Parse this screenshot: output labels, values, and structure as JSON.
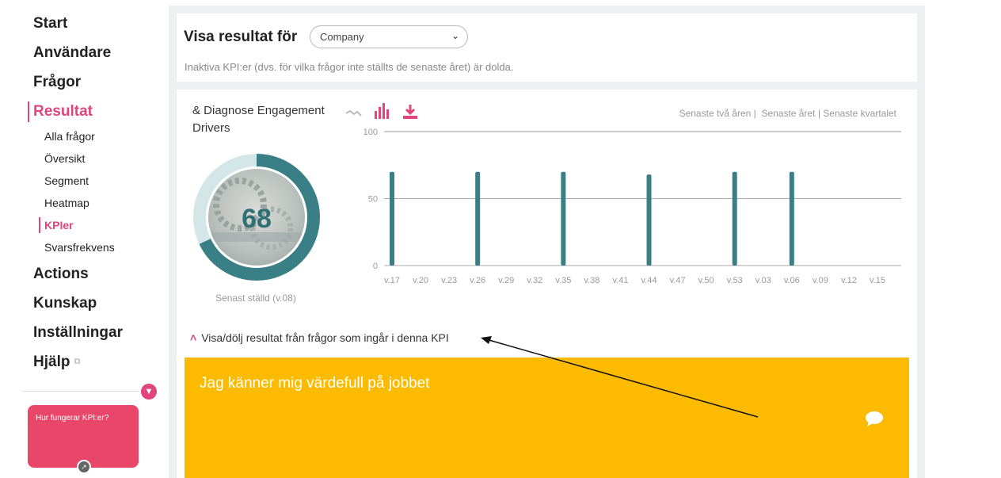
{
  "sidebar": {
    "nav": [
      {
        "label": "Start"
      },
      {
        "label": "Användare"
      },
      {
        "label": "Frågor"
      },
      {
        "label": "Resultat"
      },
      {
        "label": "Actions"
      },
      {
        "label": "Kunskap"
      },
      {
        "label": "Inställningar"
      },
      {
        "label": "Hjälp"
      }
    ],
    "sub": [
      {
        "label": "Alla frågor"
      },
      {
        "label": "Översikt"
      },
      {
        "label": "Segment"
      },
      {
        "label": "Heatmap"
      },
      {
        "label": "KPIer"
      },
      {
        "label": "Svarsfrekvens"
      }
    ],
    "help_card": "Hur fungerar KPI:er?"
  },
  "filter": {
    "title": "Visa resultat för",
    "selected": "Company",
    "note": "Inaktiva KPI:er (dvs. för vilka frågor inte ställts de senaste året) är dolda."
  },
  "kpi": {
    "title": "& Diagnose Engagement Drivers",
    "score": "68",
    "score_value": 68,
    "last_asked": "Senast ställd (v.08)",
    "periods": [
      "Senaste två åren",
      "Senaste året",
      "Senaste kvartalet"
    ],
    "toggle_label": "Visa/dölj resultat från frågor som ingår i denna KPI"
  },
  "colors": {
    "accent": "#e0457b",
    "teal": "#3a7f86",
    "yellow": "#fdbb00"
  },
  "chart_data": {
    "type": "bar",
    "categories": [
      "v.17",
      "v.20",
      "v.23",
      "v.26",
      "v.29",
      "v.32",
      "v.35",
      "v.38",
      "v.41",
      "v.44",
      "v.47",
      "v.50",
      "v.53",
      "v.03",
      "v.06",
      "v.09",
      "v.12",
      "v.15"
    ],
    "values": [
      70,
      null,
      null,
      70,
      null,
      null,
      70,
      null,
      null,
      68,
      null,
      null,
      70,
      null,
      70,
      null,
      null,
      null
    ],
    "yticks": [
      0,
      50,
      100
    ],
    "ylim": [
      0,
      100
    ],
    "grid": true
  },
  "question": {
    "text": "Jag känner mig värdefull på jobbet"
  }
}
